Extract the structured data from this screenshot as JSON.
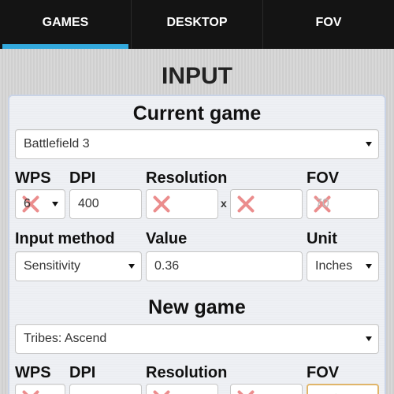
{
  "tabs": [
    {
      "label": "GAMES",
      "active": true
    },
    {
      "label": "DESKTOP",
      "active": false
    },
    {
      "label": "FOV",
      "active": false
    }
  ],
  "page_title": "INPUT",
  "current": {
    "section_title": "Current game",
    "game": "Battlefield 3",
    "labels": {
      "wps": "WPS",
      "dpi": "DPI",
      "resolution": "Resolution",
      "fov": "FOV",
      "input_method": "Input method",
      "value": "Value",
      "unit": "Unit"
    },
    "wps": "6",
    "dpi": "400",
    "res_x": "",
    "res_y": "",
    "res_sep": "x",
    "fov_placeholder": "70",
    "input_method": "Sensitivity",
    "value": "0.36",
    "unit": "Inches"
  },
  "new": {
    "section_title": "New game",
    "game": "Tribes: Ascend",
    "labels": {
      "wps": "WPS",
      "dpi": "DPI",
      "resolution": "Resolution",
      "fov": "FOV"
    },
    "res_sep": "x"
  },
  "colors": {
    "tab_accent": "#33a9dd",
    "invalid_mark": "#e87a7a",
    "valid_mark": "#6fbf6f"
  }
}
